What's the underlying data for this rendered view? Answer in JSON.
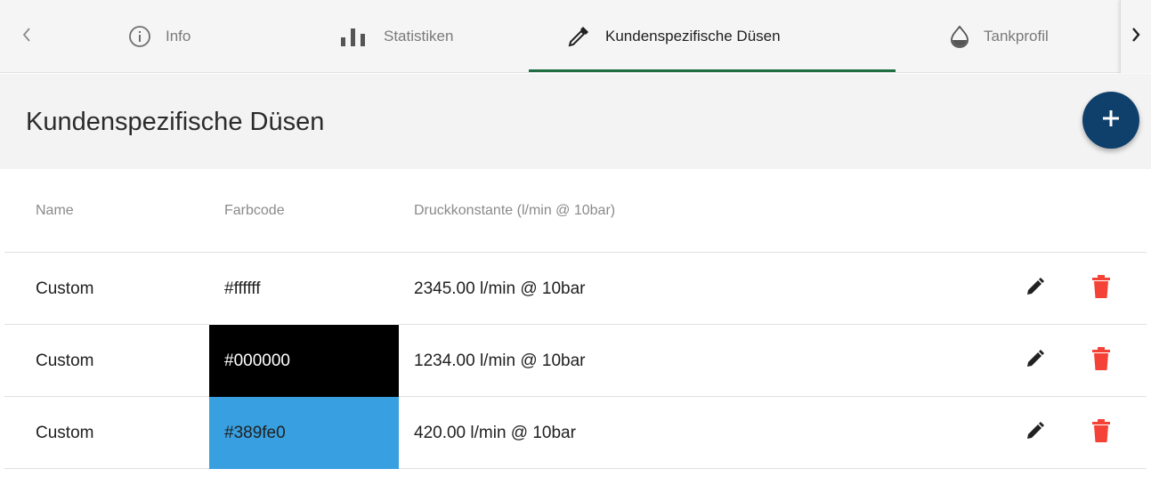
{
  "tabs": [
    {
      "label": "Info",
      "icon": "info-icon",
      "active": false
    },
    {
      "label": "Statistiken",
      "icon": "bar-chart-icon",
      "active": false
    },
    {
      "label": "Kundenspezifische Düsen",
      "icon": "eyedropper-icon",
      "active": true
    },
    {
      "label": "Tankprofil",
      "icon": "drop-icon",
      "active": false
    }
  ],
  "nav": {
    "prev_icon": "chevron-left-icon",
    "next_icon": "chevron-right-icon"
  },
  "section": {
    "title": "Kundenspezifische Düsen",
    "add_icon": "plus-icon"
  },
  "table": {
    "headers": [
      "Name",
      "Farbcode",
      "Druckkonstante (l/min @ 10bar)"
    ],
    "rows": [
      {
        "name": "Custom",
        "color_code": "#ffffff",
        "pressure": "2345.00 l/min @ 10bar",
        "text_color": "#212121"
      },
      {
        "name": "Custom",
        "color_code": "#000000",
        "pressure": "1234.00 l/min @ 10bar",
        "text_color": "#ffffff"
      },
      {
        "name": "Custom",
        "color_code": "#389fe0",
        "pressure": "420.00 l/min @ 10bar",
        "text_color": "#212121"
      }
    ]
  },
  "colors": {
    "accent": "#1e6e42",
    "fab": "#0f3f6b",
    "delete": "#f44336",
    "edit": "#212121"
  }
}
